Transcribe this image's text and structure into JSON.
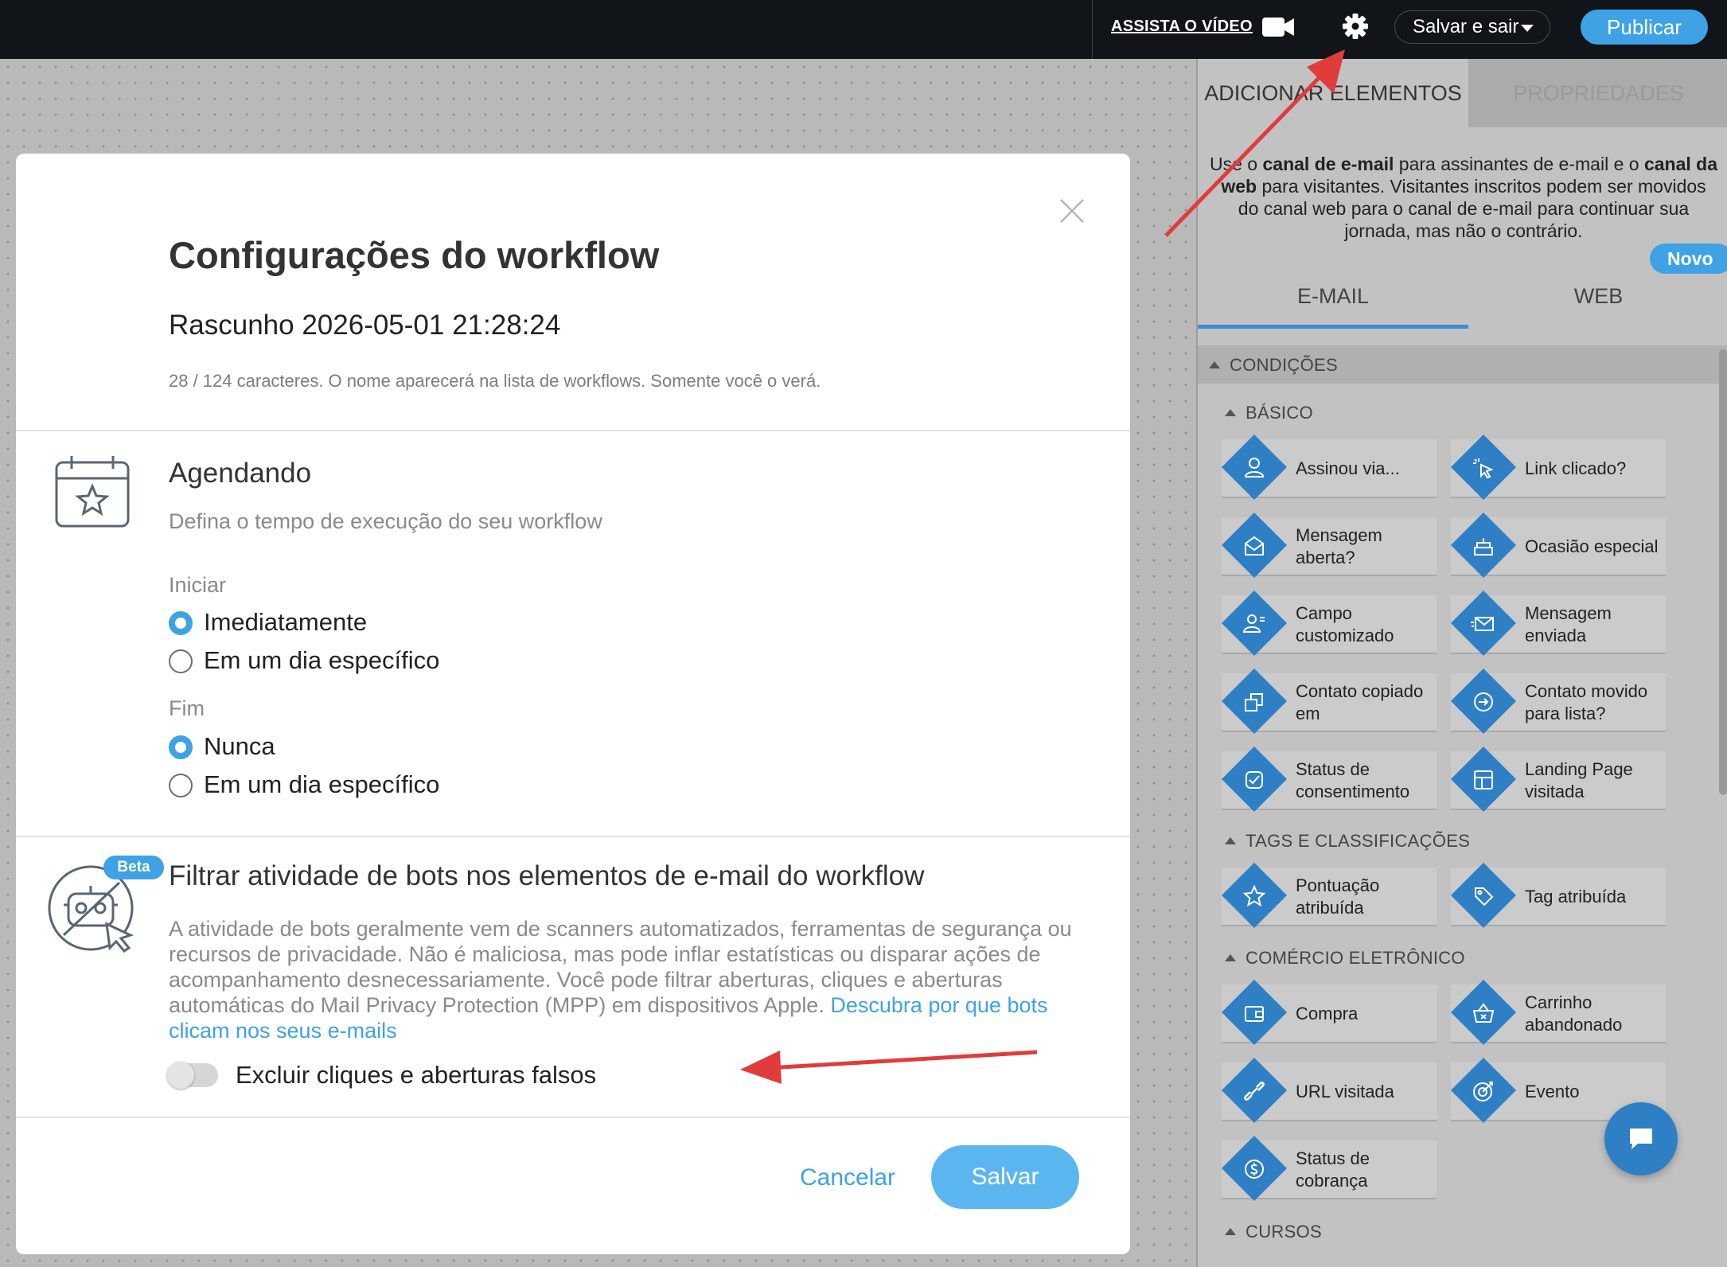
{
  "topbar": {
    "watch_video": "ASSISTA O VÍDEO",
    "save_exit": "Salvar e sair",
    "publish": "Publicar"
  },
  "panel": {
    "tab_add": "ADICIONAR ELEMENTOS",
    "tab_props": "PROPRIEDADES",
    "desc_1": "Use o ",
    "desc_b1": "canal de e-mail",
    "desc_2": " para assinantes de e-mail e o ",
    "desc_b2": "canal da web",
    "desc_3": " para visitantes. Visitantes inscritos podem ser movidos do canal web para o canal de e-mail para continuar sua jornada, mas não o contrário.",
    "novo": "Novo",
    "channel_email": "E-MAIL",
    "channel_web": "WEB",
    "conditions": "CONDIÇÕES",
    "basic": "BÁSICO",
    "tags": "TAGS E CLASSIFICAÇÕES",
    "ecommerce": "COMÉRCIO ELETRÔNICO",
    "courses": "CURSOS",
    "items": [
      {
        "label": "Assinou via...",
        "icon": "user-icon"
      },
      {
        "label": "Link clicado?",
        "icon": "cursor-click-icon"
      },
      {
        "label": "Mensagem aberta?",
        "icon": "envelope-open-icon"
      },
      {
        "label": "Ocasião especial",
        "icon": "cake-icon"
      },
      {
        "label": "Campo customizado",
        "icon": "user-field-icon"
      },
      {
        "label": "Mensagem enviada",
        "icon": "envelope-sent-icon"
      },
      {
        "label": "Contato copiado em",
        "icon": "copy-icon"
      },
      {
        "label": "Contato movido para lista?",
        "icon": "move-arrow-icon"
      },
      {
        "label": "Status de consentimento",
        "icon": "check-shield-icon"
      },
      {
        "label": "Landing Page visitada",
        "icon": "layout-icon"
      },
      {
        "label": "Pontuação atribuída",
        "icon": "star-icon"
      },
      {
        "label": "Tag atribuída",
        "icon": "tag-icon"
      },
      {
        "label": "Compra",
        "icon": "wallet-icon"
      },
      {
        "label": "Carrinho abandonado",
        "icon": "basket-icon"
      },
      {
        "label": "URL visitada",
        "icon": "link-icon"
      },
      {
        "label": "Evento",
        "icon": "target-icon"
      },
      {
        "label": "Status de cobrança",
        "icon": "billing-icon"
      }
    ]
  },
  "modal": {
    "title": "Configurações do workflow",
    "name": "Rascunho 2026-05-01 21:28:24",
    "char_count": "28 / 124 caracteres. O nome aparecerá na lista de workflows. Somente você o verá.",
    "schedule_title": "Agendando",
    "schedule_sub": "Defina o tempo de execução do seu workflow",
    "start_label": "Iniciar",
    "start_opt1": "Imediatamente",
    "start_opt2": "Em um dia específico",
    "end_label": "Fim",
    "end_opt1": "Nunca",
    "end_opt2": "Em um dia específico",
    "beta": "Beta",
    "bot_title": "Filtrar atividade de bots nos elementos de e-mail do workflow",
    "bot_desc": "A atividade de bots geralmente vem de scanners automatizados, ferramentas de segurança ou recursos de privacidade. Não é maliciosa, mas pode inflar estatísticas ou disparar ações de acompanhamento desnecessariamente. Você pode filtrar aberturas, cliques e aberturas automáticas do Mail Privacy Protection (MPP) em dispositivos Apple. ",
    "bot_link": "Descubra por que bots clicam nos seus e-mails",
    "toggle_label": "Excluir cliques e aberturas falsos",
    "toggle_on": false,
    "cancel": "Cancelar",
    "save": "Salvar"
  },
  "colors": {
    "accent": "#3ea2e5",
    "element_blue": "#2f7fc4",
    "annotation_red": "#e03c3c"
  }
}
